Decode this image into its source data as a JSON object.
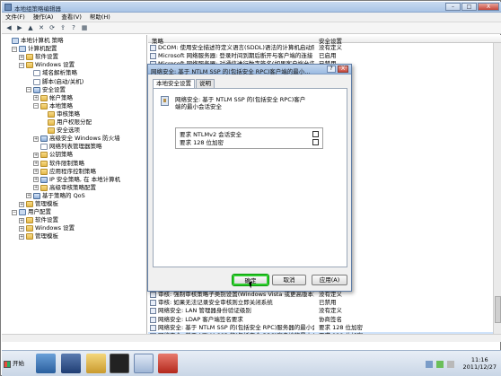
{
  "window": {
    "title": "本地组策略编辑器",
    "min": "–",
    "max": "□",
    "close": "X"
  },
  "menu": [
    "文件(F)",
    "操作(A)",
    "查看(V)",
    "帮助(H)"
  ],
  "toolbar": {
    "back": "◀",
    "forward": "▶",
    "up": "▲",
    "delete": "✕",
    "refresh": "⟳",
    "export": "⇪",
    "help": "?",
    "view": "▦"
  },
  "tree": [
    {
      "label": "本地计算机 策略",
      "level": 0,
      "exp": "",
      "icon": "comp"
    },
    {
      "label": "计算机配置",
      "level": 1,
      "exp": "−",
      "icon": "comp"
    },
    {
      "label": "软件设置",
      "level": 2,
      "exp": "+",
      "icon": "folder"
    },
    {
      "label": "Windows 设置",
      "level": 2,
      "exp": "−",
      "icon": "folder"
    },
    {
      "label": "域名解析策略",
      "level": 3,
      "exp": "",
      "icon": "doc"
    },
    {
      "label": "脚本(启动/关机)",
      "level": 3,
      "exp": "",
      "icon": "doc"
    },
    {
      "label": "安全设置",
      "level": 3,
      "exp": "−",
      "icon": "shield"
    },
    {
      "label": "帐户策略",
      "level": 4,
      "exp": "+",
      "icon": "folder"
    },
    {
      "label": "本地策略",
      "level": 4,
      "exp": "−",
      "icon": "folder"
    },
    {
      "label": "审核策略",
      "level": 5,
      "exp": "",
      "icon": "folder"
    },
    {
      "label": "用户权限分配",
      "level": 5,
      "exp": "",
      "icon": "folder"
    },
    {
      "label": "安全选项",
      "level": 5,
      "exp": "",
      "icon": "folder"
    },
    {
      "label": "高级安全 Windows 防火墙",
      "level": 4,
      "exp": "+",
      "icon": "shield"
    },
    {
      "label": "网络列表管理器策略",
      "level": 4,
      "exp": "",
      "icon": "doc"
    },
    {
      "label": "公钥策略",
      "level": 4,
      "exp": "+",
      "icon": "folder"
    },
    {
      "label": "软件限制策略",
      "level": 4,
      "exp": "+",
      "icon": "folder"
    },
    {
      "label": "应用程序控制策略",
      "level": 4,
      "exp": "+",
      "icon": "folder"
    },
    {
      "label": "IP 安全策略, 在 本地计算机",
      "level": 4,
      "exp": "+",
      "icon": "shield"
    },
    {
      "label": "高级审核策略配置",
      "level": 4,
      "exp": "+",
      "icon": "folder"
    },
    {
      "label": "基于策略的 QoS",
      "level": 3,
      "exp": "+",
      "icon": "shield"
    },
    {
      "label": "管理模板",
      "level": 2,
      "exp": "+",
      "icon": "folder"
    },
    {
      "label": "用户配置",
      "level": 1,
      "exp": "−",
      "icon": "comp"
    },
    {
      "label": "软件设置",
      "level": 2,
      "exp": "+",
      "icon": "folder"
    },
    {
      "label": "Windows 设置",
      "level": 2,
      "exp": "+",
      "icon": "folder"
    },
    {
      "label": "管理模板",
      "level": 2,
      "exp": "+",
      "icon": "folder"
    }
  ],
  "list": {
    "col1": "策略",
    "col2": "安全设置",
    "top_rows": [
      {
        "policy": "DCOM: 使用安全描述符定义语言(SDDL)语法的计算机启动限制",
        "setting": "没有定义"
      },
      {
        "policy": "Microsoft 网络服务器: 登录时间到期后断开与客户端的连接",
        "setting": "已启用"
      },
      {
        "policy": "Microsoft 网络服务器: 对通信进行数字签名(如果客户端允许)",
        "setting": "已禁用"
      }
    ],
    "bottom_rows": [
      {
        "policy": "审核: 强制审核策略子类别设置(Windows Vista 或更高版本)",
        "setting": "没有定义"
      },
      {
        "policy": "审核: 如果无法记录安全审核则立即关闭系统",
        "setting": "已禁用"
      },
      {
        "policy": "网络安全: LAN 管理器身份验证级别",
        "setting": "没有定义"
      },
      {
        "policy": "网络安全: LDAP 客户端签名要求",
        "setting": "协商签名"
      },
      {
        "policy": "网络安全: 基于 NTLM SSP 的(包括安全 RPC)服务器的最小会话安全",
        "setting": "要求 128 位加密"
      },
      {
        "policy": "网络安全: 基于 NTLM SSP 的(包括安全 RPC)客户端的最小会话安全",
        "setting": "要求 128 位加密"
      }
    ]
  },
  "dialog": {
    "title": "网络安全: 基于 NTLM SSP 的(包括安全 RPC)客户端的最小...",
    "help": "?",
    "close": "X",
    "tabs": [
      "本地安全设置",
      "说明"
    ],
    "description": "网络安全: 基于 NTLM SSP 的(包括安全 RPC)客户端的最小会话安全",
    "options": [
      {
        "label": "要求 NTLMv2 会话安全",
        "checked": false
      },
      {
        "label": "要求 128 位加密",
        "checked": false
      }
    ],
    "ok": "确定",
    "cancel": "取消",
    "apply": "应用(A)"
  },
  "taskbar": {
    "start": "开始",
    "time": "11:16",
    "date": "2011/12/27"
  }
}
